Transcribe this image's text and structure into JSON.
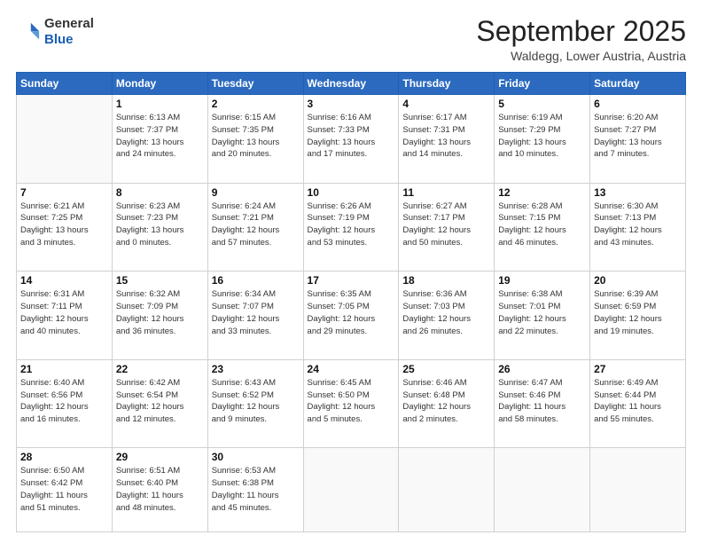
{
  "header": {
    "logo_general": "General",
    "logo_blue": "Blue",
    "month": "September 2025",
    "location": "Waldegg, Lower Austria, Austria"
  },
  "days_of_week": [
    "Sunday",
    "Monday",
    "Tuesday",
    "Wednesday",
    "Thursday",
    "Friday",
    "Saturday"
  ],
  "weeks": [
    [
      {
        "day": "",
        "info": ""
      },
      {
        "day": "1",
        "info": "Sunrise: 6:13 AM\nSunset: 7:37 PM\nDaylight: 13 hours\nand 24 minutes."
      },
      {
        "day": "2",
        "info": "Sunrise: 6:15 AM\nSunset: 7:35 PM\nDaylight: 13 hours\nand 20 minutes."
      },
      {
        "day": "3",
        "info": "Sunrise: 6:16 AM\nSunset: 7:33 PM\nDaylight: 13 hours\nand 17 minutes."
      },
      {
        "day": "4",
        "info": "Sunrise: 6:17 AM\nSunset: 7:31 PM\nDaylight: 13 hours\nand 14 minutes."
      },
      {
        "day": "5",
        "info": "Sunrise: 6:19 AM\nSunset: 7:29 PM\nDaylight: 13 hours\nand 10 minutes."
      },
      {
        "day": "6",
        "info": "Sunrise: 6:20 AM\nSunset: 7:27 PM\nDaylight: 13 hours\nand 7 minutes."
      }
    ],
    [
      {
        "day": "7",
        "info": "Sunrise: 6:21 AM\nSunset: 7:25 PM\nDaylight: 13 hours\nand 3 minutes."
      },
      {
        "day": "8",
        "info": "Sunrise: 6:23 AM\nSunset: 7:23 PM\nDaylight: 13 hours\nand 0 minutes."
      },
      {
        "day": "9",
        "info": "Sunrise: 6:24 AM\nSunset: 7:21 PM\nDaylight: 12 hours\nand 57 minutes."
      },
      {
        "day": "10",
        "info": "Sunrise: 6:26 AM\nSunset: 7:19 PM\nDaylight: 12 hours\nand 53 minutes."
      },
      {
        "day": "11",
        "info": "Sunrise: 6:27 AM\nSunset: 7:17 PM\nDaylight: 12 hours\nand 50 minutes."
      },
      {
        "day": "12",
        "info": "Sunrise: 6:28 AM\nSunset: 7:15 PM\nDaylight: 12 hours\nand 46 minutes."
      },
      {
        "day": "13",
        "info": "Sunrise: 6:30 AM\nSunset: 7:13 PM\nDaylight: 12 hours\nand 43 minutes."
      }
    ],
    [
      {
        "day": "14",
        "info": "Sunrise: 6:31 AM\nSunset: 7:11 PM\nDaylight: 12 hours\nand 40 minutes."
      },
      {
        "day": "15",
        "info": "Sunrise: 6:32 AM\nSunset: 7:09 PM\nDaylight: 12 hours\nand 36 minutes."
      },
      {
        "day": "16",
        "info": "Sunrise: 6:34 AM\nSunset: 7:07 PM\nDaylight: 12 hours\nand 33 minutes."
      },
      {
        "day": "17",
        "info": "Sunrise: 6:35 AM\nSunset: 7:05 PM\nDaylight: 12 hours\nand 29 minutes."
      },
      {
        "day": "18",
        "info": "Sunrise: 6:36 AM\nSunset: 7:03 PM\nDaylight: 12 hours\nand 26 minutes."
      },
      {
        "day": "19",
        "info": "Sunrise: 6:38 AM\nSunset: 7:01 PM\nDaylight: 12 hours\nand 22 minutes."
      },
      {
        "day": "20",
        "info": "Sunrise: 6:39 AM\nSunset: 6:59 PM\nDaylight: 12 hours\nand 19 minutes."
      }
    ],
    [
      {
        "day": "21",
        "info": "Sunrise: 6:40 AM\nSunset: 6:56 PM\nDaylight: 12 hours\nand 16 minutes."
      },
      {
        "day": "22",
        "info": "Sunrise: 6:42 AM\nSunset: 6:54 PM\nDaylight: 12 hours\nand 12 minutes."
      },
      {
        "day": "23",
        "info": "Sunrise: 6:43 AM\nSunset: 6:52 PM\nDaylight: 12 hours\nand 9 minutes."
      },
      {
        "day": "24",
        "info": "Sunrise: 6:45 AM\nSunset: 6:50 PM\nDaylight: 12 hours\nand 5 minutes."
      },
      {
        "day": "25",
        "info": "Sunrise: 6:46 AM\nSunset: 6:48 PM\nDaylight: 12 hours\nand 2 minutes."
      },
      {
        "day": "26",
        "info": "Sunrise: 6:47 AM\nSunset: 6:46 PM\nDaylight: 11 hours\nand 58 minutes."
      },
      {
        "day": "27",
        "info": "Sunrise: 6:49 AM\nSunset: 6:44 PM\nDaylight: 11 hours\nand 55 minutes."
      }
    ],
    [
      {
        "day": "28",
        "info": "Sunrise: 6:50 AM\nSunset: 6:42 PM\nDaylight: 11 hours\nand 51 minutes."
      },
      {
        "day": "29",
        "info": "Sunrise: 6:51 AM\nSunset: 6:40 PM\nDaylight: 11 hours\nand 48 minutes."
      },
      {
        "day": "30",
        "info": "Sunrise: 6:53 AM\nSunset: 6:38 PM\nDaylight: 11 hours\nand 45 minutes."
      },
      {
        "day": "",
        "info": ""
      },
      {
        "day": "",
        "info": ""
      },
      {
        "day": "",
        "info": ""
      },
      {
        "day": "",
        "info": ""
      }
    ]
  ]
}
